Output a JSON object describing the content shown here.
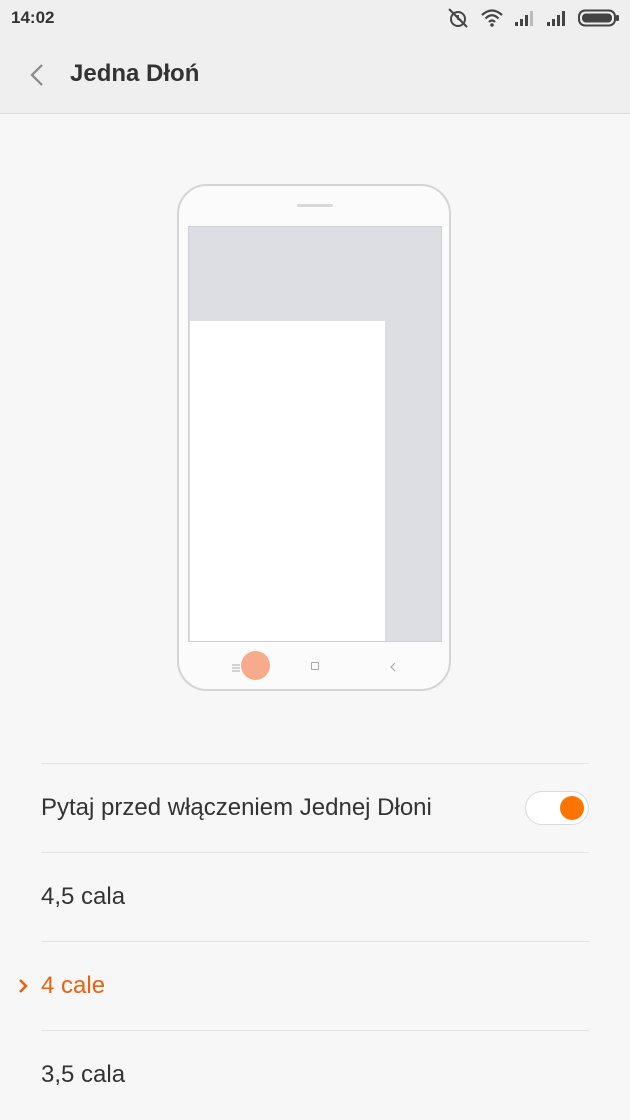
{
  "status_bar": {
    "time": "14:02",
    "icons": [
      "alarm-off-icon",
      "wifi-icon",
      "signal-icon",
      "signal-icon",
      "battery-icon"
    ]
  },
  "header": {
    "title": "Jedna Dłoń",
    "back_icon": "chevron-left-icon"
  },
  "colors": {
    "accent": "#ff7400",
    "selected_text": "#e8620f",
    "nav_dot": "#f7ab8d"
  },
  "settings": {
    "ask_before_enable": {
      "label": "Pytaj przed włączeniem Jednej Dłoni",
      "toggle_on": true
    },
    "sizes": [
      {
        "label": "4,5 cala",
        "selected": false
      },
      {
        "label": "4 cale",
        "selected": true
      },
      {
        "label": "3,5 cala",
        "selected": false
      }
    ]
  }
}
